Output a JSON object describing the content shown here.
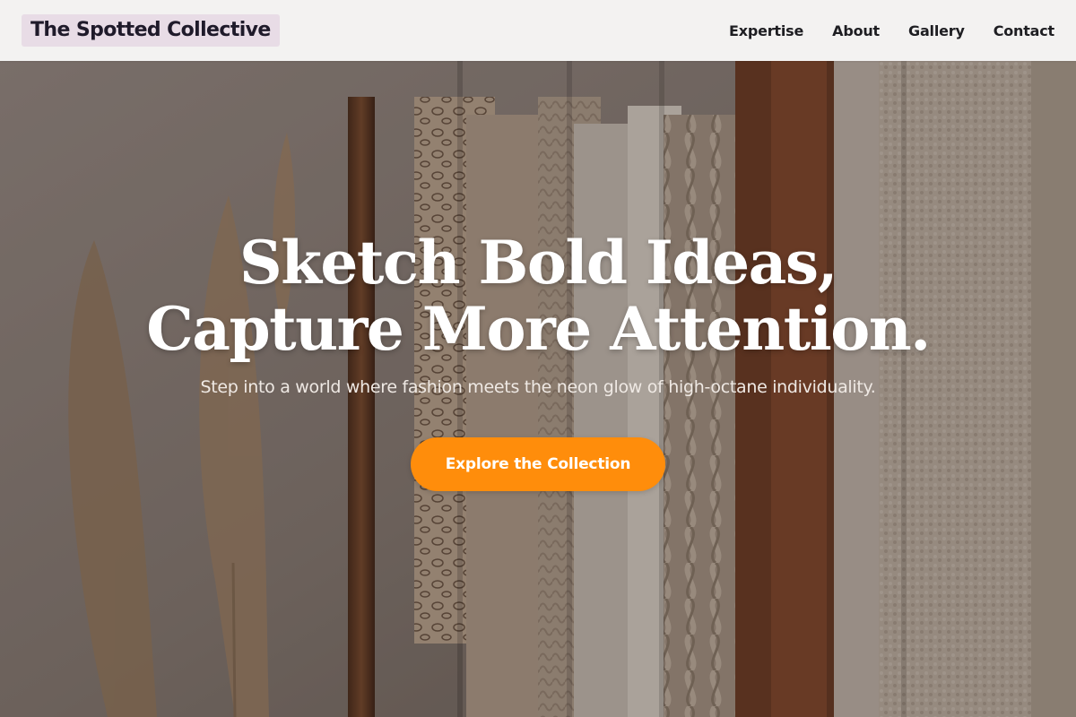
{
  "header": {
    "brand": "The Spotted Collective",
    "nav": [
      {
        "label": "Expertise"
      },
      {
        "label": "About"
      },
      {
        "label": "Gallery"
      },
      {
        "label": "Contact"
      }
    ]
  },
  "hero": {
    "headline_line1": "Sketch Bold Ideas,",
    "headline_line2": "Capture More Attention.",
    "subheadline": "Step into a world where fashion meets the neon glow of high-octane individuality.",
    "cta_label": "Explore the Collection"
  },
  "colors": {
    "accent": "#ff8d0b",
    "brand_bg": "#e8dce6",
    "header_bg": "#f3f2f1"
  }
}
